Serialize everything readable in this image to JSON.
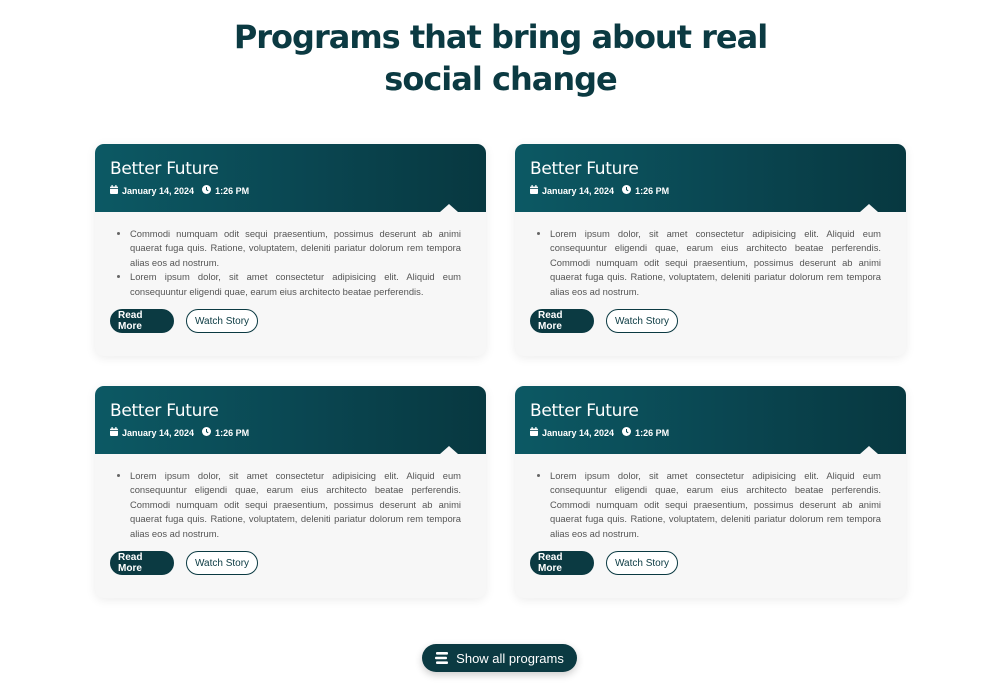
{
  "heading": {
    "line1": "Programs that bring about real",
    "line2": "social change"
  },
  "cards": [
    {
      "title": "Better Future",
      "date": "January 14, 2024",
      "time": "1:26 PM",
      "bullets": [
        "Commodi numquam odit sequi praesentium, possimus deserunt ab animi quaerat fuga quis. Ratione, voluptatem, deleniti pariatur dolorum rem tempora alias eos ad nostrum.",
        "Lorem ipsum dolor, sit amet consectetur adipisicing elit. Aliquid eum consequuntur eligendi quae, earum eius architecto beatae perferendis."
      ],
      "read_more": "Read More",
      "watch_story": "Watch Story"
    },
    {
      "title": "Better Future",
      "date": "January 14, 2024",
      "time": "1:26 PM",
      "bullets": [
        "Lorem ipsum dolor, sit amet consectetur adipisicing elit. Aliquid eum consequuntur eligendi quae, earum eius architecto beatae perferendis. Commodi numquam odit sequi praesentium, possimus deserunt ab animi quaerat fuga quis. Ratione, voluptatem, deleniti pariatur dolorum rem tempora alias eos ad nostrum."
      ],
      "read_more": "Read More",
      "watch_story": "Watch Story"
    },
    {
      "title": "Better Future",
      "date": "January 14, 2024",
      "time": "1:26 PM",
      "bullets": [
        "Lorem ipsum dolor, sit amet consectetur adipisicing elit. Aliquid eum consequuntur eligendi quae, earum eius architecto beatae perferendis. Commodi numquam odit sequi praesentium, possimus deserunt ab animi quaerat fuga quis. Ratione, voluptatem, deleniti pariatur dolorum rem tempora alias eos ad nostrum."
      ],
      "read_more": "Read More",
      "watch_story": "Watch Story"
    },
    {
      "title": "Better Future",
      "date": "January 14, 2024",
      "time": "1:26 PM",
      "bullets": [
        "Lorem ipsum dolor, sit amet consectetur adipisicing elit. Aliquid eum consequuntur eligendi quae, earum eius architecto beatae perferendis. Commodi numquam odit sequi praesentium, possimus deserunt ab animi quaerat fuga quis. Ratione, voluptatem, deleniti pariatur dolorum rem tempora alias eos ad nostrum."
      ],
      "read_more": "Read More",
      "watch_story": "Watch Story"
    }
  ],
  "show_all": {
    "label": "Show all programs",
    "icon": "list-icon"
  },
  "icons": {
    "date": "calendar-icon",
    "time": "clock-icon"
  },
  "colors": {
    "primary": "#0b3a42",
    "header_gradient_start": "#0c5964",
    "header_gradient_end": "#073840",
    "card_background": "#f7f7f7"
  }
}
